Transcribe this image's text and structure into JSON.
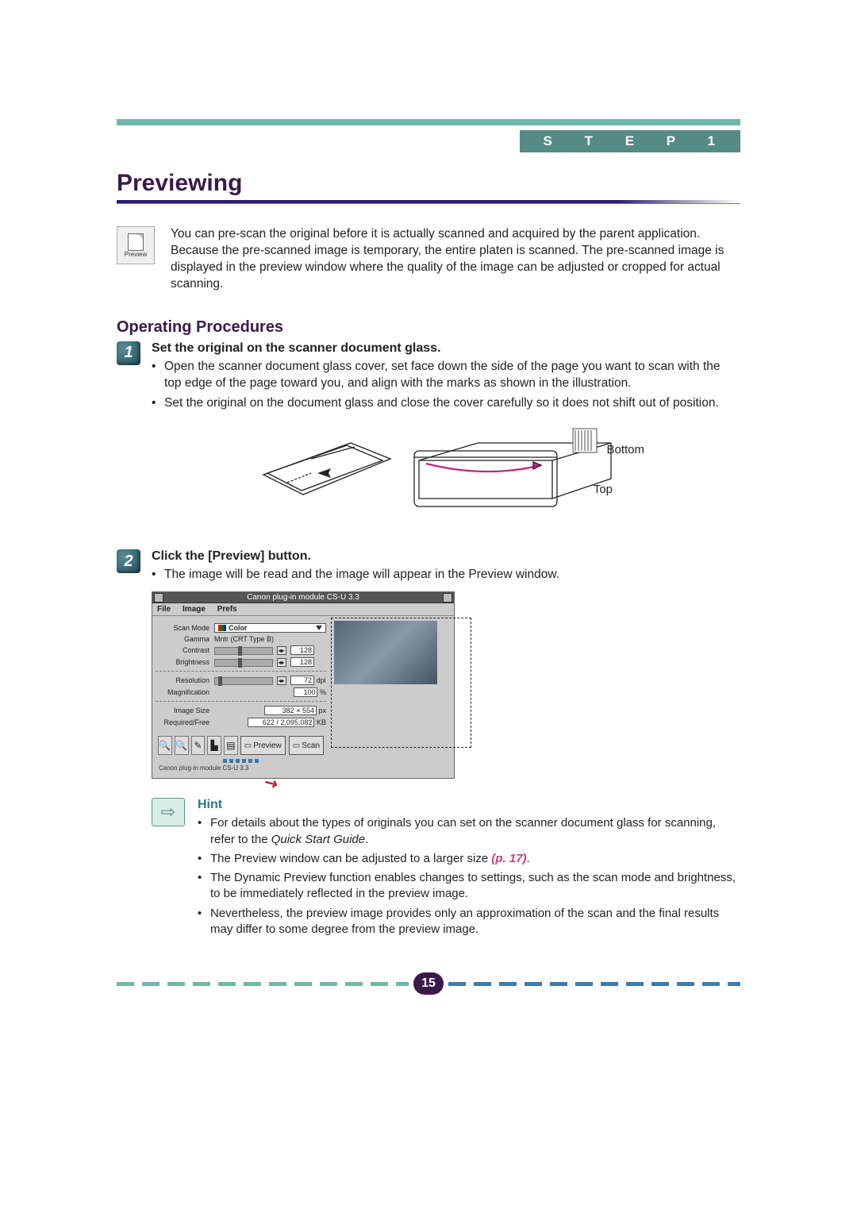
{
  "header": {
    "step_label": "S T E P  1",
    "title": "Previewing"
  },
  "preview_icon_label": "Preview",
  "intro": "You can pre-scan the original before it is actually scanned and acquired by the parent application. Because the pre-scanned image is temporary, the entire platen is scanned. The pre-scanned image is displayed in the preview window where the quality of the image can be adjusted or cropped for actual scanning.",
  "section_title": "Operating Procedures",
  "steps": [
    {
      "num": "1",
      "title": "Set the original on the scanner document glass.",
      "bullets": [
        "Open the scanner document glass cover, set face down the side of the page you want to scan with the top edge of the page toward you,  and align with the marks as shown in the illustration.",
        "Set the original on the document glass and close the cover carefully so it does not shift out of position."
      ]
    },
    {
      "num": "2",
      "title": "Click the [Preview] button.",
      "bullets": [
        "The image will be read and the image will appear in the Preview window."
      ]
    }
  ],
  "illustration_labels": {
    "bottom": "Bottom",
    "top": "Top"
  },
  "screenshot": {
    "title": "Canon plug-in module  CS-U 3.3",
    "menubar": [
      "File",
      "Image",
      "Prefs"
    ],
    "rows": {
      "scan_mode": {
        "label": "Scan Mode",
        "value": "Color"
      },
      "gamma": {
        "label": "Gamma",
        "value": "Mntr (CRT Type B)"
      },
      "contrast": {
        "label": "Contrast",
        "value": "128"
      },
      "brightness": {
        "label": "Brightness",
        "value": "128"
      },
      "resolution": {
        "label": "Resolution",
        "value": "72",
        "unit": "dpi"
      },
      "magnification": {
        "label": "Magnification",
        "value": "100",
        "unit": "%"
      },
      "image_size": {
        "label": "Image Size",
        "value": "382 × 554",
        "unit": "px"
      },
      "required_free": {
        "label": "Required/Free",
        "value": "622 / 2,095,082",
        "unit": "KB"
      }
    },
    "buttons": {
      "preview": "Preview",
      "scan": "Scan"
    },
    "status": "Canon plug-in module CS-U 3.3"
  },
  "hint": {
    "title": "Hint",
    "bullets": [
      {
        "text_a": "For details about the types of originals you can set on the scanner document glass for scanning, refer to the ",
        "italic": "Quick Start Guide",
        "text_b": "."
      },
      {
        "text_a": "The Preview window can be adjusted to a larger size ",
        "ref": "(p. 17)",
        "text_b": "."
      },
      {
        "text_a": "The Dynamic Preview function enables changes to settings, such as the scan mode and brightness, to be immediately reflected in the preview image."
      },
      {
        "text_a": "Nevertheless, the preview image provides only an approximation of the scan and the final results may differ to some degree from the preview image."
      }
    ]
  },
  "page_number": "15"
}
